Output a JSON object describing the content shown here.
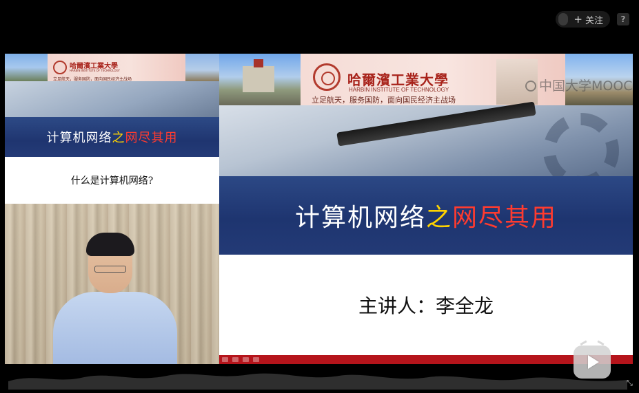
{
  "top_bar": {
    "follow_plus": "+",
    "follow_label": "关注",
    "help_glyph": "?"
  },
  "left_slide": {
    "uni_name_small": "哈爾濱工業大學",
    "uni_eng_small": "HARBIN INSTITUTE OF TECHNOLOGY",
    "uni_motto_small": "立足航天，服务国防，面向国民经济主战场",
    "title_white": "计算机网络",
    "title_yellow": "之",
    "title_red": "网尽其用",
    "question": "什么是计算机网络?"
  },
  "right_slide": {
    "uni_name": "哈爾濱工業大學",
    "uni_eng": "HARBIN INSTITUTE OF TECHNOLOGY",
    "uni_motto": "立足航天，服务国防，面向国民经济主战场",
    "watermark": "中国大学MOOC",
    "title_white": "计算机网络",
    "title_yellow": "之",
    "title_red": "网尽其用",
    "presenter": "主讲人：李全龙"
  },
  "colors": {
    "title_band": "#1e3570",
    "title_yellow": "#ffd400",
    "title_red": "#ff3b2f",
    "bottom_bar": "#b5141b",
    "university_red": "#a8231b"
  },
  "icons": {
    "play": "play-icon",
    "help": "help-icon",
    "fullscreen": "fullscreen-icon"
  }
}
